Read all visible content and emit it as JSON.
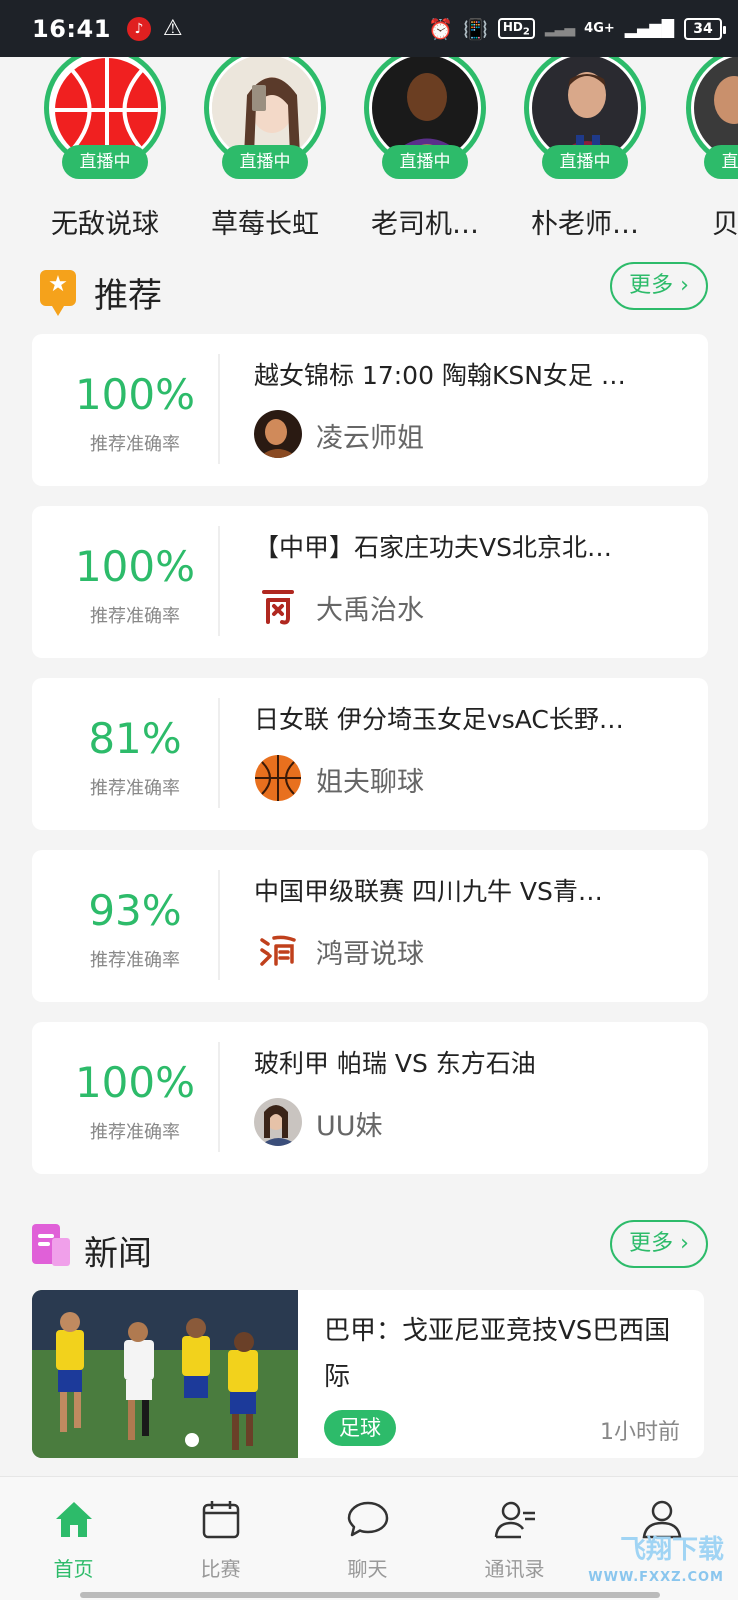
{
  "status_bar": {
    "time": "16:41",
    "hd": "HD",
    "hd_sub": "2",
    "network": "4G+",
    "battery": "34"
  },
  "live": {
    "badge": "直播中",
    "streamers": [
      {
        "name": "无敌说球"
      },
      {
        "name": "草莓长虹"
      },
      {
        "name": "老司机…"
      },
      {
        "name": "朴老师…"
      },
      {
        "name": "贝"
      }
    ]
  },
  "recommend": {
    "title": "推荐",
    "more": "更多",
    "rate_label": "推荐准确率",
    "items": [
      {
        "rate": "100%",
        "title": "越女锦标 17:00 陶翰KSN女足 …",
        "author": "凌云师姐"
      },
      {
        "rate": "100%",
        "title": "【中甲】石家庄功夫VS北京北…",
        "author": "大禹治水"
      },
      {
        "rate": "81%",
        "title": "日女联 伊分埼玉女足vsAC长野…",
        "author": "姐夫聊球"
      },
      {
        "rate": "93%",
        "title": "中国甲级联赛 四川九牛 VS青…",
        "author": "鸿哥说球"
      },
      {
        "rate": "100%",
        "title": "玻利甲 帕瑞 VS 东方石油",
        "author": "UU妹"
      }
    ]
  },
  "news": {
    "title": "新闻",
    "more": "更多",
    "item": {
      "title": "巴甲：戈亚尼亚竞技VS巴西国际",
      "tag": "足球",
      "time": "1小时前"
    }
  },
  "nav": {
    "items": [
      {
        "label": "首页"
      },
      {
        "label": "比赛"
      },
      {
        "label": "聊天"
      },
      {
        "label": "通讯录"
      },
      {
        "label": ""
      }
    ]
  },
  "watermark": {
    "text": "飞翔下载",
    "sub": "WWW.FXXZ.COM"
  },
  "colors": {
    "accent": "#2dbb6a",
    "star_icon": "#f5a21b",
    "news_icon": "#e060d8"
  }
}
